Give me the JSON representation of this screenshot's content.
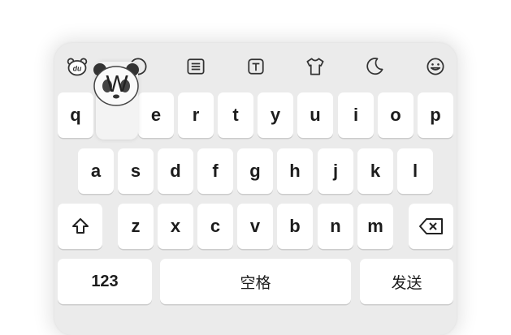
{
  "toolbar": {
    "icons": [
      "panda-logo-icon",
      "emoji-icon",
      "clipboard-icon",
      "text-edit-icon",
      "theme-shirt-icon",
      "dark-mode-icon",
      "smiley-icon"
    ],
    "logo_text": "du"
  },
  "popup": {
    "char": "W"
  },
  "rows": [
    [
      "q",
      "w",
      "e",
      "r",
      "t",
      "y",
      "u",
      "i",
      "o",
      "p"
    ],
    [
      "a",
      "s",
      "d",
      "f",
      "g",
      "h",
      "j",
      "k",
      "l"
    ],
    [
      "z",
      "x",
      "c",
      "v",
      "b",
      "n",
      "m"
    ]
  ],
  "bottom": {
    "numbers": "123",
    "space": "空格",
    "send": "发送"
  },
  "colors": {
    "panel": "#ebebeb",
    "key": "#ffffff",
    "text": "#1c1c1c"
  }
}
